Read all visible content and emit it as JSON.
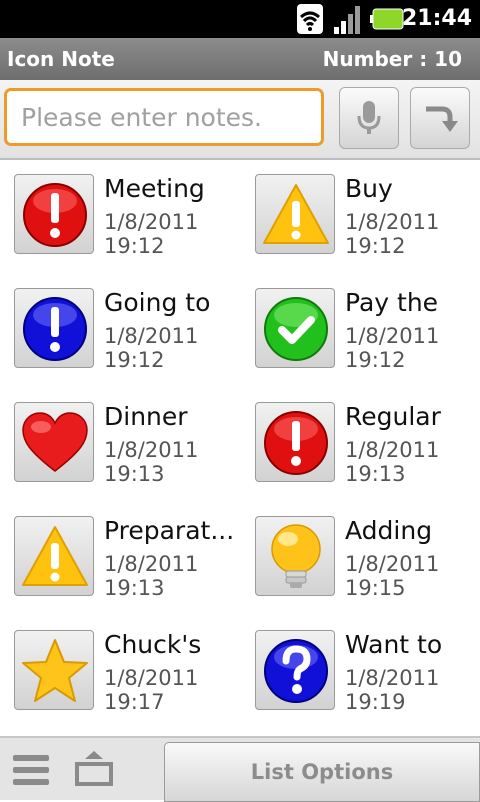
{
  "status_bar": {
    "time": "21:44",
    "icons": [
      "wifi-icon",
      "signal-icon",
      "battery-icon"
    ]
  },
  "title_bar": {
    "title": "Icon Note",
    "count_label": "Number : 10"
  },
  "input": {
    "placeholder": "Please enter notes.",
    "value": ""
  },
  "buttons": {
    "mic": "microphone-icon",
    "submit": "turn-arrow-icon"
  },
  "notes": [
    {
      "title": "Meeting",
      "date": "1/8/2011",
      "time": "19:12",
      "icon": "red-exclamation-icon"
    },
    {
      "title": "Buy",
      "date": "1/8/2011",
      "time": "19:12",
      "icon": "warning-triangle-icon"
    },
    {
      "title": "Going to",
      "date": "1/8/2011",
      "time": "19:12",
      "icon": "blue-exclamation-icon"
    },
    {
      "title": "Pay the",
      "date": "1/8/2011",
      "time": "19:12",
      "icon": "green-check-icon"
    },
    {
      "title": "Dinner",
      "date": "1/8/2011",
      "time": "19:13",
      "icon": "heart-icon"
    },
    {
      "title": "Regular",
      "date": "1/8/2011",
      "time": "19:13",
      "icon": "red-exclamation-icon"
    },
    {
      "title": "Preparat...",
      "date": "1/8/2011",
      "time": "19:13",
      "icon": "warning-triangle-icon"
    },
    {
      "title": "Adding",
      "date": "1/8/2011",
      "time": "19:15",
      "icon": "lightbulb-icon"
    },
    {
      "title": "Chuck's",
      "date": "1/8/2011",
      "time": "19:17",
      "icon": "star-icon"
    },
    {
      "title": "Want to",
      "date": "1/8/2011",
      "time": "19:19",
      "icon": "blue-question-icon"
    }
  ],
  "bottom_bar": {
    "list_options": "List Options"
  },
  "colors": {
    "accent_orange": "#ef9a2b",
    "title_bar": "#7d7d7d"
  }
}
